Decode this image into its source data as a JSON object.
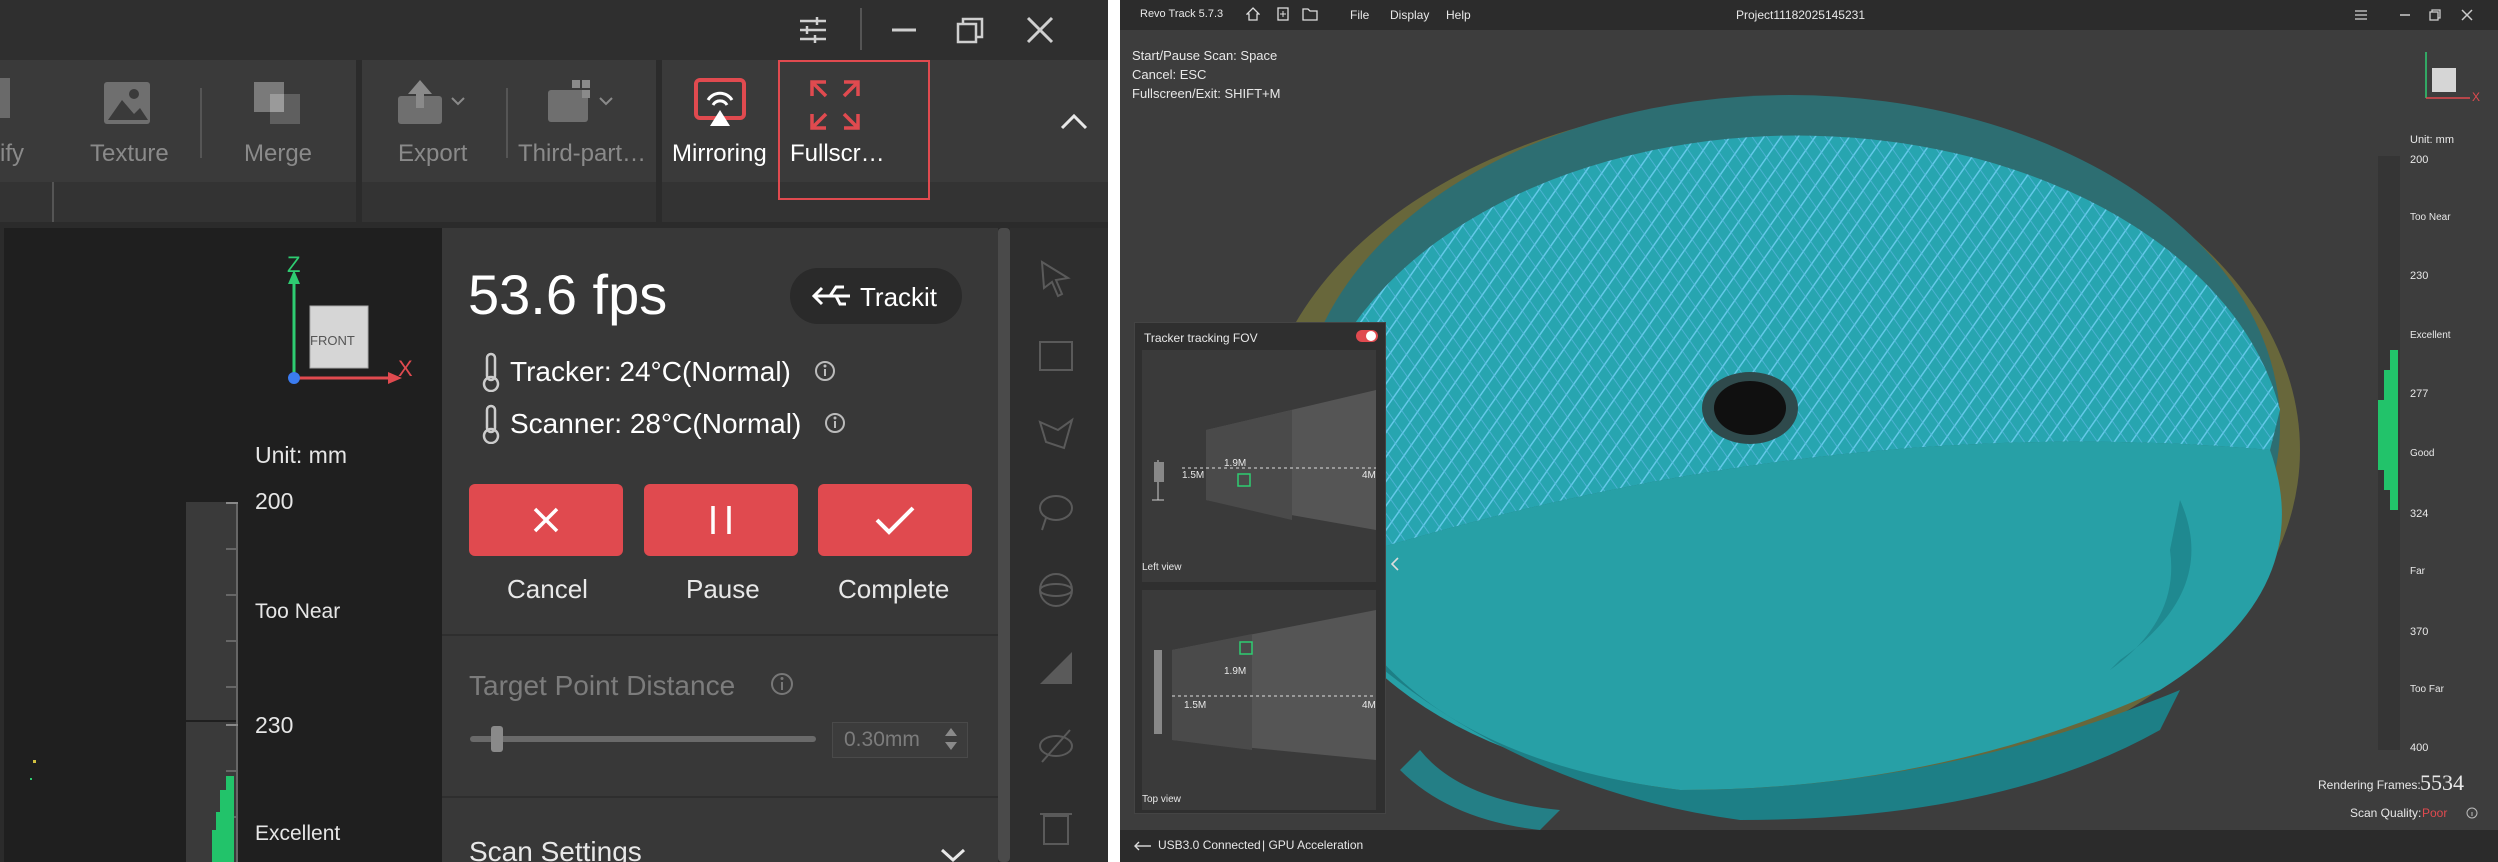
{
  "left": {
    "ribbon": {
      "modify_label": "ify",
      "texture_label": "Texture",
      "merge_label": "Merge",
      "export_label": "Export",
      "third_party_label": "Third-part…",
      "mirroring_label": "Mirroring",
      "fullscreen_label": "Fullscr…"
    },
    "viewport": {
      "axis_z": "Z",
      "axis_x": "X",
      "cube_face": "FRONT",
      "unit": "Unit: mm",
      "scale_200": "200",
      "too_near": "Too Near",
      "scale_230": "230",
      "excellent": "Excellent"
    },
    "panel": {
      "fps": "53.6 fps",
      "trackit_label": "Trackit",
      "tracker_temp": "Tracker: 24°C(Normal)",
      "scanner_temp": "Scanner: 28°C(Normal)",
      "cancel_label": "Cancel",
      "pause_label": "Pause",
      "complete_label": "Complete",
      "target_distance_label": "Target Point Distance",
      "target_distance_value": "0.30mm",
      "target_distance_slider_fraction": 0.06,
      "scan_settings_label": "Scan Settings"
    },
    "colors": {
      "accent_red": "#e04a4f",
      "panel_bg": "#383838"
    }
  },
  "right": {
    "title": {
      "app_name": "Revo Track 5.7.3",
      "menu_file": "File",
      "menu_display": "Display",
      "menu_help": "Help",
      "project": "Project11182025145231"
    },
    "shortcuts": {
      "start_pause": "Start/Pause Scan:  Space",
      "cancel": "Cancel:  ESC",
      "fullscreen": "Fullscreen/Exit:  SHIFT+M"
    },
    "fov": {
      "title": "Tracker tracking FOV",
      "toggle_on": true,
      "left_view_label": "Left view",
      "top_view_label": "Top view",
      "d1": "1.5M",
      "d2": "1.9M",
      "d3": "4M"
    },
    "scale": {
      "unit": "Unit: mm",
      "v200": "200",
      "too_near": "Too Near",
      "v230": "230",
      "excellent": "Excellent",
      "v277": "277",
      "good": "Good",
      "v324": "324",
      "far": "Far",
      "v370": "370",
      "too_far": "Too Far",
      "v400": "400"
    },
    "rendering_frames_label": "Rendering Frames:",
    "rendering_frames_value": "5534",
    "scan_quality_label": "Scan Quality:",
    "scan_quality_value": "Poor",
    "status": {
      "usb": "USB3.0 Connected",
      "gpu": "| GPU Acceleration"
    },
    "axis_x": "X"
  }
}
